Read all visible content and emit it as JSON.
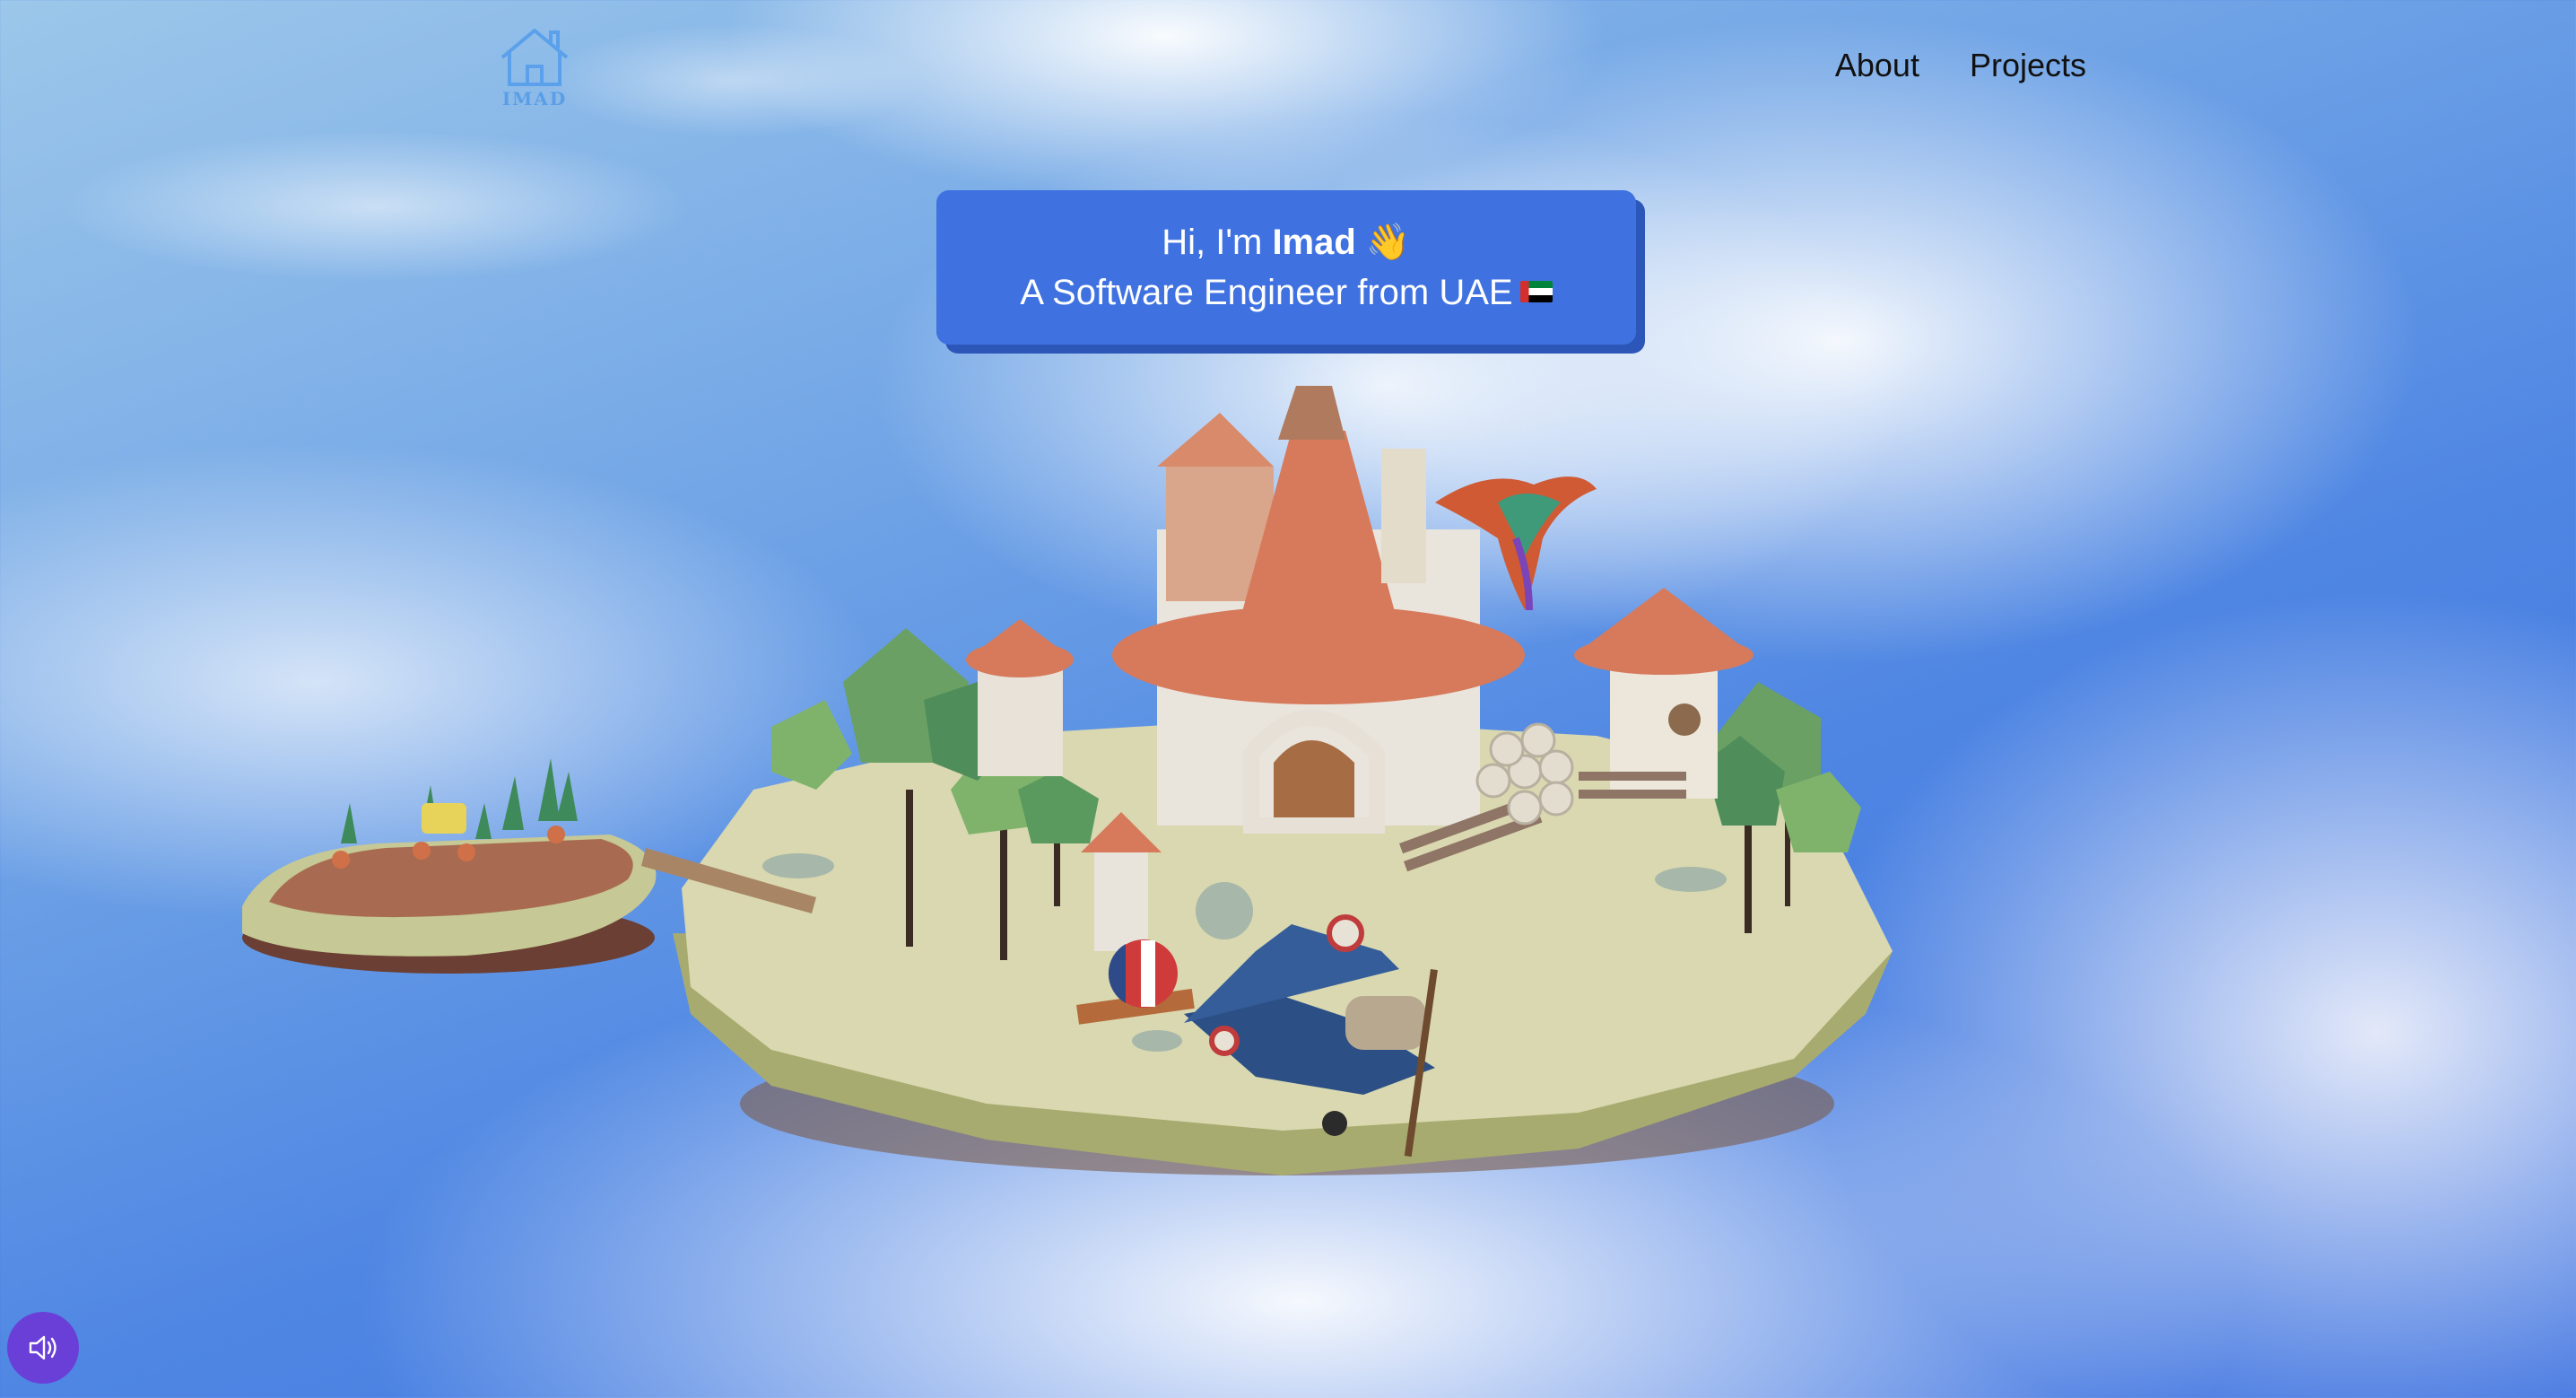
{
  "header": {
    "logo_text": "IMAD",
    "logo_icon": "house-icon",
    "nav": [
      {
        "label": "About"
      },
      {
        "label": "Projects"
      }
    ]
  },
  "intro": {
    "greeting_prefix": "Hi, I'm ",
    "name": "Imad",
    "wave_emoji": "👋",
    "tagline": "A Software Engineer from UAE",
    "flag_icon": "uae-flag-icon"
  },
  "scene": {
    "description_icon": "floating-island-3d-scene"
  },
  "controls": {
    "sound_icon": "speaker-icon"
  },
  "colors": {
    "accent": "#3f72e0",
    "accent_shadow": "#2c57b8",
    "sound_button": "#6a3fd8",
    "logo": "#5a9ee8"
  }
}
